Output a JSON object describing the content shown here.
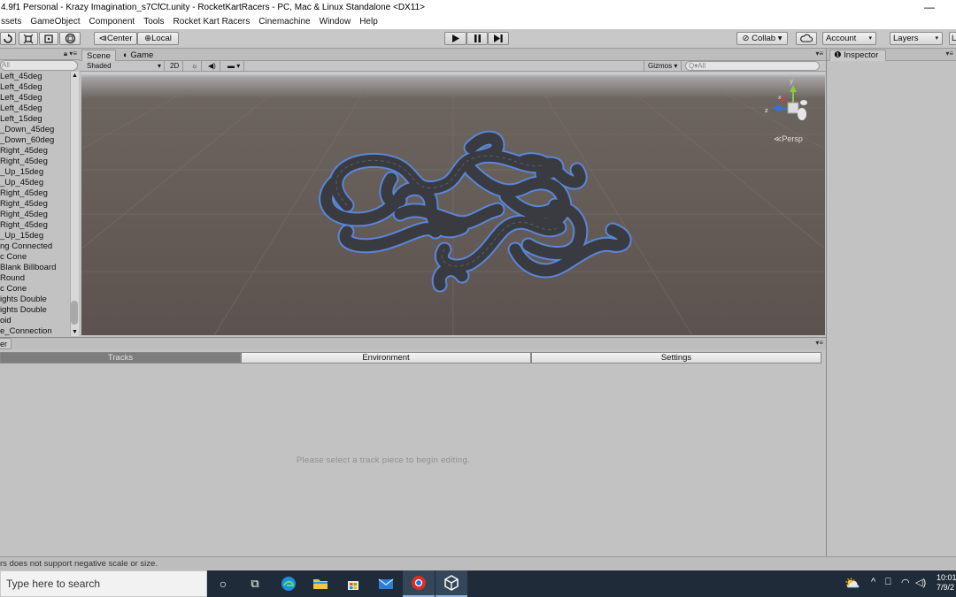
{
  "window": {
    "title": "4.9f1 Personal - Krazy Imagination_s7CfCt.unity - RocketKartRacers - PC, Mac & Linux Standalone <DX11>",
    "minimize": "—"
  },
  "menu": [
    "ssets",
    "GameObject",
    "Component",
    "Tools",
    "Rocket Kart Racers",
    "Cinemachine",
    "Window",
    "Help"
  ],
  "toolbar": {
    "pivot_label": "Center",
    "space_label": "Local",
    "collab_label": "Collab ▾",
    "account_label": "Account",
    "layers_label": "Layers",
    "layout_label": "L"
  },
  "hierarchy": {
    "search_placeholder": "All",
    "items": [
      "Left_45deg",
      "Left_45deg",
      "Left_45deg",
      "Left_45deg",
      "Left_15deg",
      "_Down_45deg",
      "_Down_60deg",
      "Right_45deg",
      "Right_45deg",
      "_Up_15deg",
      "_Up_45deg",
      "Right_45deg",
      "Right_45deg",
      "Right_45deg",
      "Right_45deg",
      "_Up_15deg",
      "ng Connected",
      "c Cone",
      "Blank Billboard",
      "Round",
      "c Cone",
      "ights Double",
      "ights Double",
      "oid",
      "e_Connection"
    ]
  },
  "scene": {
    "tab_scene": "Scene",
    "tab_game": "Game",
    "shading": "Shaded",
    "mode_2d": "2D",
    "gizmos": "Gizmos",
    "search_placeholder": "All",
    "persp_label": "Persp"
  },
  "track_editor": {
    "panel_tab": "er",
    "tabs": [
      "Tracks",
      "Environment",
      "Settings"
    ],
    "hint": "Please select a track piece to begin editing."
  },
  "inspector": {
    "tab_label": "Inspector"
  },
  "status": {
    "message": "rs does not support negative scale or size."
  },
  "taskbar": {
    "search_placeholder": "Type here to search",
    "time": "10:01",
    "date": "7/9/2"
  }
}
